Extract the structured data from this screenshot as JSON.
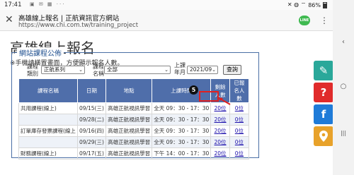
{
  "status": {
    "time": "17:41",
    "battery": "86%",
    "left_icons": "▣ ✉ ▦ ···",
    "right_icons": "✕ ◍ ⌔"
  },
  "browser": {
    "title": "高雄線上報名 | 正航資訊官方網站",
    "url": "https://www.chi.com.tw/training_project",
    "close_glyph": "✕",
    "line_label": "LINE",
    "more_glyph": "⋮"
  },
  "page": {
    "title": "高雄線上報名",
    "notice": "※手機請橫置畫面，方便顯示報名人數。",
    "section_title": "網站課程公佈"
  },
  "filters": {
    "category_label_1": "課程",
    "category_label_2": "類別",
    "category_value": "正航系列",
    "name_label_1": "課程",
    "name_label_2": "名稱",
    "name_value": "全部",
    "month_label_1": "上課",
    "month_label_2": "年月",
    "month_value": "2021/09",
    "query_label": "查詢"
  },
  "table": {
    "headers": [
      "課程名稱",
      "日期",
      "地點",
      "上課時間",
      "剩餘人數",
      "已報名人數"
    ],
    "rows": [
      {
        "name": "共用課程(線上)",
        "date": "09/15(三)",
        "place": "高雄正航視訊學習",
        "time": "全天 09：30 - 17：30",
        "remaining": "20位",
        "registered": "0位"
      },
      {
        "name": "",
        "date": "09/28(二)",
        "place": "高雄正航視訊學習",
        "time": "全天 09：30 - 17：30",
        "remaining": "20位",
        "registered": "0位"
      },
      {
        "name": "訂單庫存發票課程(線上",
        "date": "09/16(四)",
        "place": "高雄正航視訊學習",
        "time": "全天 09：30 - 17：30",
        "remaining": "20位",
        "registered": "0位"
      },
      {
        "name": "",
        "date": "09/29(三)",
        "place": "高雄正航視訊學習",
        "time": "全天 09：30 - 17：30",
        "remaining": "20位",
        "registered": "0位"
      },
      {
        "name": "財務課程(線上)",
        "date": "09/17(五)",
        "place": "高雄正航視訊學習",
        "time": "下午 14：00 - 17：30",
        "remaining": "20位",
        "registered": "0位"
      }
    ]
  },
  "annotation": {
    "step": "5"
  },
  "side_buttons": [
    {
      "icon": "pencil-icon",
      "glyph": "✎",
      "color": "#2aa89a"
    },
    {
      "icon": "question-icon",
      "glyph": "?",
      "color": "#e02b2b"
    },
    {
      "icon": "facebook-icon",
      "glyph": "f",
      "color": "#1f7bd8"
    },
    {
      "icon": "location-pin-icon",
      "glyph": "⬤",
      "color": "#e8a22a"
    }
  ],
  "nav": {
    "back_glyph": "‹",
    "home_glyph": "○",
    "recent_glyph": "|||"
  }
}
